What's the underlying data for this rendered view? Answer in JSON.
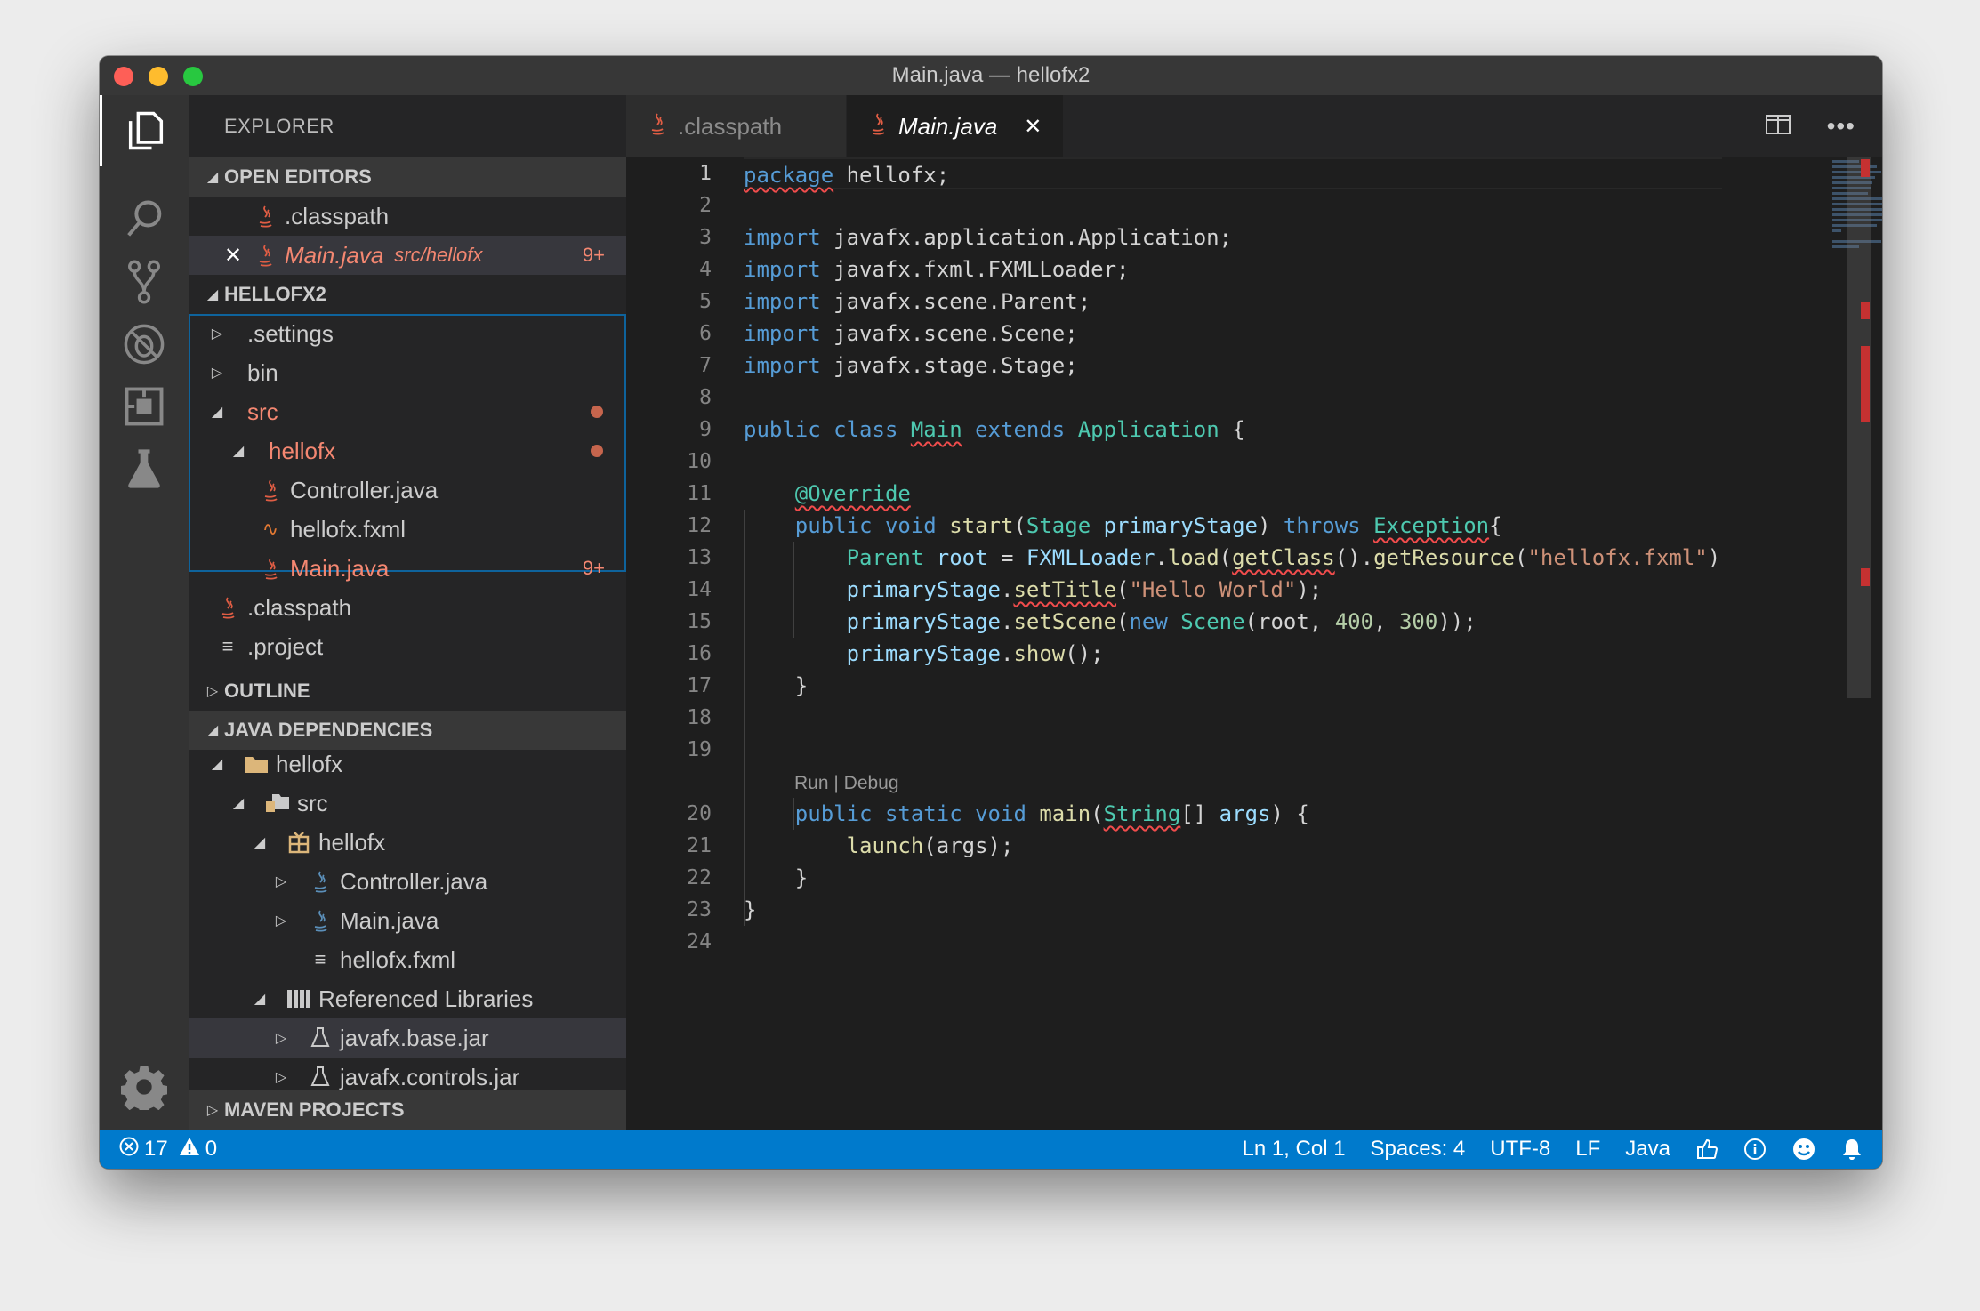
{
  "window": {
    "title": "Main.java — hellofx2"
  },
  "activity_bar": {
    "items": [
      "files-icon",
      "search-icon",
      "source-control-icon",
      "debug-icon",
      "extensions-icon",
      "test-flask-icon"
    ],
    "bottom": "gear-icon"
  },
  "sidebar": {
    "title": "EXPLORER",
    "open_editors": {
      "label": "OPEN EDITORS",
      "items": [
        {
          "name": ".classpath"
        },
        {
          "name": "Main.java",
          "path": "src/hellofx",
          "badge": "9+"
        }
      ]
    },
    "project": {
      "label": "HELLOFX2",
      "items": [
        {
          "name": ".settings"
        },
        {
          "name": "bin"
        },
        {
          "name": "src"
        },
        {
          "name": "hellofx"
        },
        {
          "name": "Controller.java"
        },
        {
          "name": "hellofx.fxml"
        },
        {
          "name": "Main.java",
          "badge": "9+"
        },
        {
          "name": ".classpath"
        },
        {
          "name": ".project"
        }
      ]
    },
    "outline": {
      "label": "OUTLINE"
    },
    "java_dependencies": {
      "label": "JAVA DEPENDENCIES",
      "items": [
        {
          "name": "hellofx"
        },
        {
          "name": "src"
        },
        {
          "name": "hellofx"
        },
        {
          "name": "Controller.java"
        },
        {
          "name": "Main.java"
        },
        {
          "name": "hellofx.fxml"
        },
        {
          "name": "Referenced Libraries"
        },
        {
          "name": "javafx.base.jar"
        },
        {
          "name": "javafx.controls.jar"
        }
      ]
    },
    "maven": {
      "label": "MAVEN PROJECTS"
    }
  },
  "tabs": [
    {
      "label": ".classpath"
    },
    {
      "label": "Main.java",
      "close": "✕"
    }
  ],
  "editor": {
    "line_numbers": [
      "1",
      "2",
      "3",
      "4",
      "5",
      "6",
      "7",
      "8",
      "9",
      "10",
      "11",
      "12",
      "13",
      "14",
      "15",
      "16",
      "17",
      "18",
      "19",
      "",
      "20",
      "21",
      "22",
      "23",
      "24"
    ],
    "code_lens": "Run | Debug",
    "colors": {
      "keyword": "#569cd6",
      "type": "#4ec9b0",
      "function": "#dcdcaa",
      "string": "#ce9178",
      "number": "#b5cea8",
      "variable": "#9cdcfe"
    }
  },
  "status_bar": {
    "errors": "17",
    "warnings": "0",
    "position": "Ln 1, Col 1",
    "spaces": "Spaces: 4",
    "encoding": "UTF-8",
    "eol": "LF",
    "language": "Java",
    "color": "#007acc"
  }
}
